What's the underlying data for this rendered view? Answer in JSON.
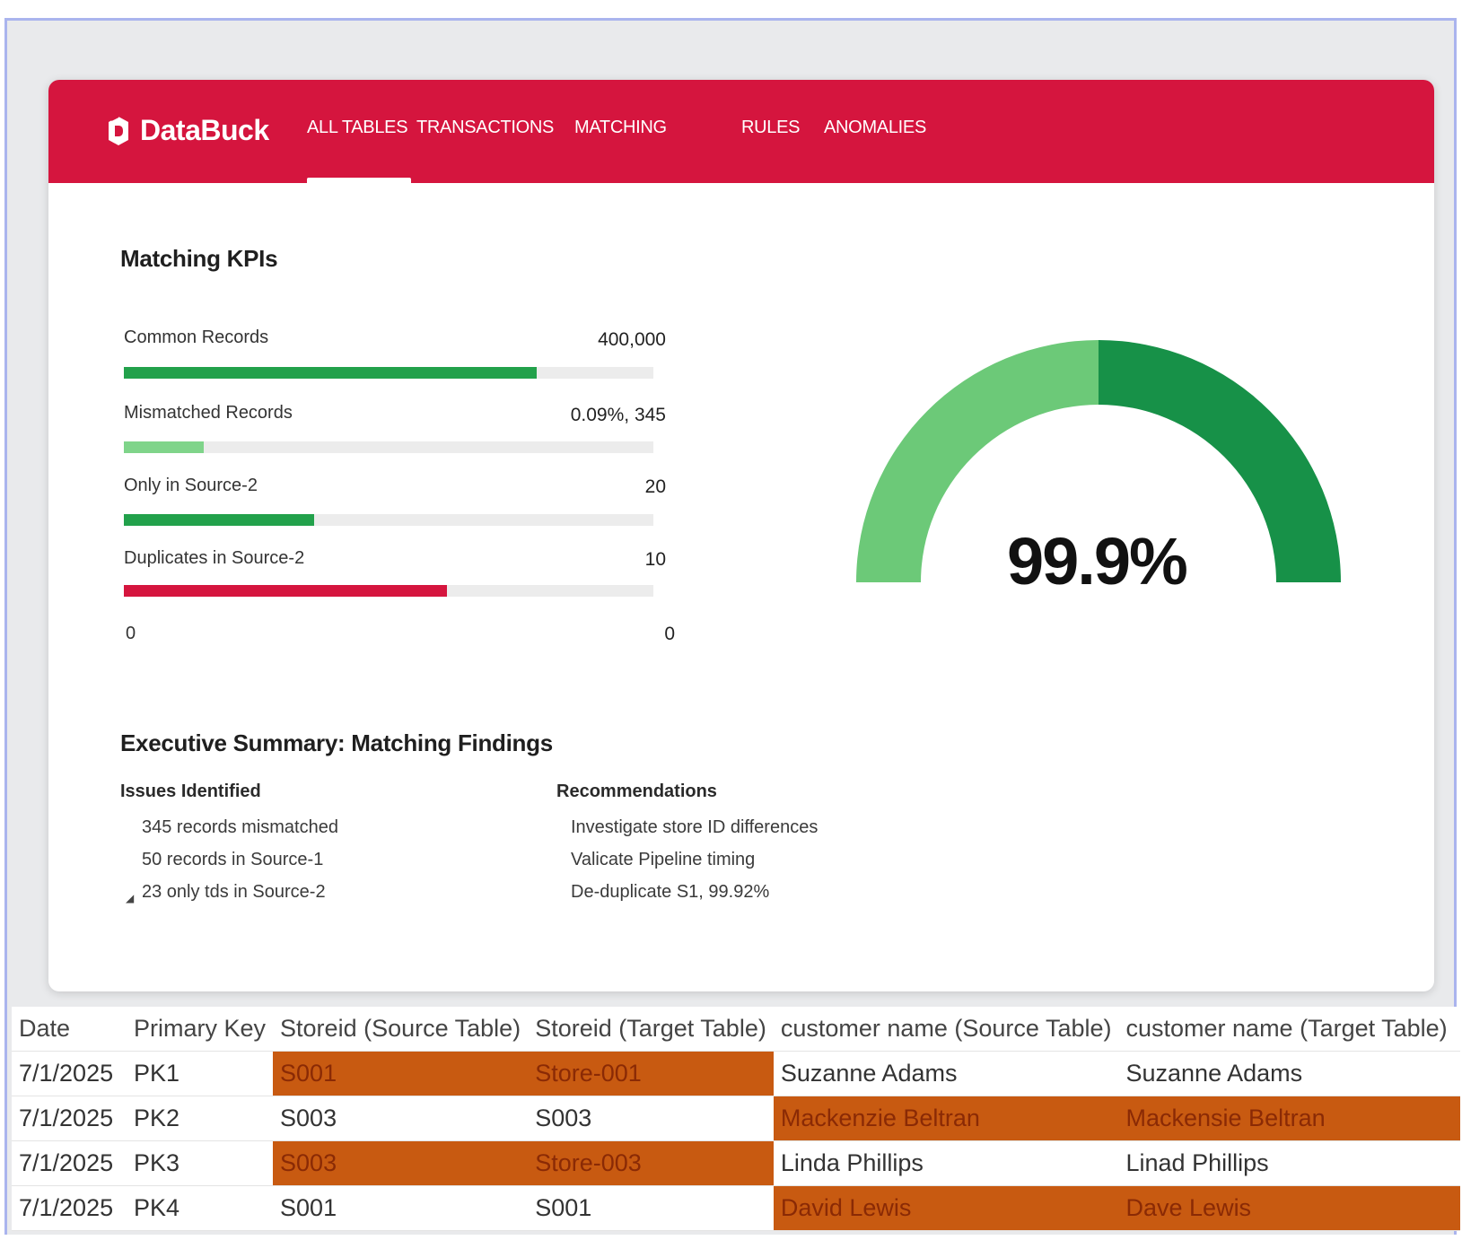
{
  "app": {
    "brand": "DataBuck",
    "accent": "#d5153e"
  },
  "nav": {
    "tabs": [
      {
        "label": "ALL TABLES",
        "active": true
      },
      {
        "label": "TRANSACTIONS",
        "active": false
      },
      {
        "label": "MATCHING",
        "active": false
      },
      {
        "label": "RULES",
        "active": false
      },
      {
        "label": "ANOMALIES",
        "active": false
      }
    ]
  },
  "kpis": {
    "title": "Matching KPIs",
    "items": [
      {
        "label": "Common Records",
        "value": "400,000",
        "fill_fraction": 0.78,
        "color": "#22a14b"
      },
      {
        "label": "Mismatched Records",
        "value": "0.09%, 345",
        "fill_fraction": 0.15,
        "color": "#7fd48a"
      },
      {
        "label": "Only in Source-2",
        "value": "20",
        "fill_fraction": 0.36,
        "color": "#22a14b"
      },
      {
        "label": "Duplicates in Source-2",
        "value": "10",
        "fill_fraction": 0.61,
        "color": "#d5153e"
      }
    ],
    "axis_min": "0",
    "axis_max": "0"
  },
  "gauge": {
    "value_text": "99.9%",
    "value": 99.9,
    "colors": {
      "left": "#6cc978",
      "right": "#179148"
    }
  },
  "summary": {
    "title": "Executive Summary: Matching Findings",
    "issues_heading": "Issues Identified",
    "issues": [
      "345 records mismatched",
      "50 records in Source-1",
      "23 only tds in Source-2"
    ],
    "recommendations_heading": "Recommendations",
    "recommendations": [
      "Investigate store ID differences",
      "Valicate Pipeline timing",
      "De-duplicate S1, 99.92%"
    ]
  },
  "table": {
    "highlight_color": "#c85a11",
    "columns": [
      "Date",
      "Primary Key",
      "Storeid (Source Table)",
      "Storeid (Target Table)",
      "customer name (Source Table)",
      "customer name (Target Table)"
    ],
    "rows": [
      {
        "date": "7/1/2025",
        "pk": "PK1",
        "store_src": "S001",
        "store_tgt": "Store-001",
        "cust_src": "Suzanne Adams",
        "cust_tgt": "Suzanne Adams",
        "store_mismatch": true,
        "cust_mismatch": false
      },
      {
        "date": "7/1/2025",
        "pk": "PK2",
        "store_src": "S003",
        "store_tgt": "S003",
        "cust_src": "Mackenzie Beltran",
        "cust_tgt": "Mackensie Beltran",
        "store_mismatch": false,
        "cust_mismatch": true
      },
      {
        "date": "7/1/2025",
        "pk": "PK3",
        "store_src": "S003",
        "store_tgt": "Store-003",
        "cust_src": "Linda Phillips",
        "cust_tgt": "Linad Phillips",
        "store_mismatch": true,
        "cust_mismatch": false
      },
      {
        "date": "7/1/2025",
        "pk": "PK4",
        "store_src": "S001",
        "store_tgt": "S001",
        "cust_src": "David Lewis",
        "cust_tgt": "Dave Lewis",
        "store_mismatch": false,
        "cust_mismatch": true
      }
    ]
  }
}
